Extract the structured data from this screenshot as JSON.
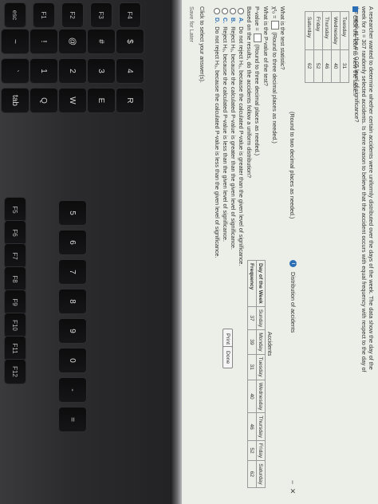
{
  "keyboard": {
    "col1": [
      "esc",
      "~",
      "`",
      "tab"
    ],
    "col2": [
      "F1",
      "!",
      "1",
      "Q"
    ],
    "col3": [
      "F2",
      "@",
      "2",
      "W"
    ],
    "col4": [
      "F3",
      "#",
      "3",
      "E"
    ],
    "col5": [
      "F4",
      "$",
      "4",
      "R"
    ],
    "row_f": [
      "F5",
      "F6",
      "F7",
      "F8",
      "F9",
      "F10",
      "F11",
      "F12"
    ],
    "row_num": [
      "5",
      "6",
      "7",
      "8",
      "9",
      "0",
      "-",
      "="
    ]
  },
  "question": {
    "intro": "A researcher wanted to determine whether certain accidents were uniformly distributed over the days of the week. The data show the day of the week for n = 307 randomly selected accidents. Is there reason to believe that the accident occurs with equal frequency with respect to the day of the week at the α = 0.05 level of significance?",
    "icon_hint": "Click the icon to view the table.",
    "partial_rows": [
      {
        "day": "Tuesday",
        "value": "31"
      },
      {
        "day": "Wednesday",
        "value": "40"
      },
      {
        "day": "Thursday",
        "value": "46"
      },
      {
        "day": "Friday",
        "value": "52"
      },
      {
        "day": "Saturday",
        "value": "62"
      }
    ],
    "round_two": "(Round to two decimal places as needed.)",
    "q_test_stat": "What is the test statistic?",
    "chi_label": "χ²₀ =",
    "round_three_1": "(Round to three decimal places as needed.)",
    "q_pvalue": "What is the P-value of the test?",
    "pvalue_label": "P-value =",
    "round_three_2": "(Round to three decimal places as needed.)",
    "q_conclusion": "Based on the results, do the accidents follow a uniform distribution?",
    "options": [
      {
        "letter": "A.",
        "text": "Do not reject H₀, because the calculated P-value is greater than the given level of significance."
      },
      {
        "letter": "B.",
        "text": "Reject H₀, because the calculated P-value is greater than the given level of significance."
      },
      {
        "letter": "C.",
        "text": "Reject H₀, because the calculated P-value is less than the given level of significance."
      },
      {
        "letter": "D.",
        "text": "Do not reject H₀, because the calculated P-value is less than the given level of significance."
      }
    ],
    "click_note": "Click to select your answer(s).",
    "save_label": "Save for Later"
  },
  "popup": {
    "title": "Distribution of accidents",
    "caption": "Accidents",
    "header_label": "Day of the Week",
    "freq_label": "Frequency",
    "days": [
      "Sunday",
      "Monday",
      "Tuesday",
      "Wednesday",
      "Thursday",
      "Friday",
      "Saturday"
    ],
    "freqs": [
      "37",
      "39",
      "31",
      "40",
      "46",
      "52",
      "62"
    ],
    "print_label": "Print",
    "done_label": "Done",
    "min_glyph": "−",
    "close_glyph": "✕"
  },
  "colors": {
    "accent": "#2a6fb5",
    "screen_bg": "#eceee8"
  }
}
